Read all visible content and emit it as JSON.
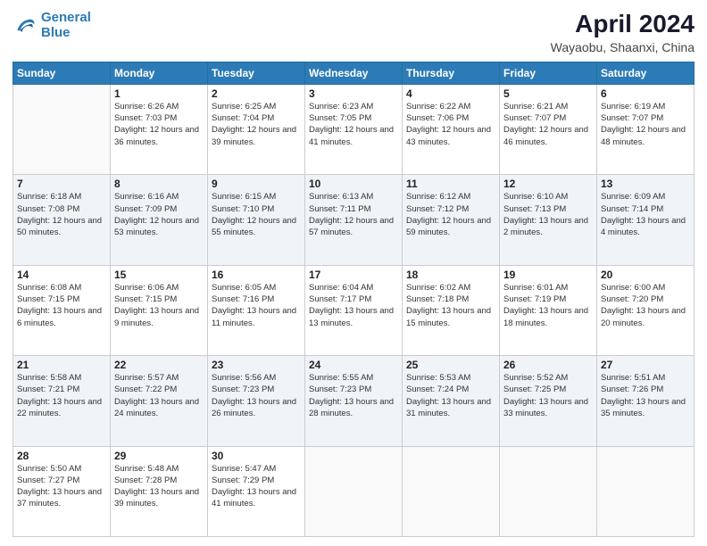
{
  "header": {
    "logo_line1": "General",
    "logo_line2": "Blue",
    "title": "April 2024",
    "subtitle": "Wayaobu, Shaanxi, China"
  },
  "weekdays": [
    "Sunday",
    "Monday",
    "Tuesday",
    "Wednesday",
    "Thursday",
    "Friday",
    "Saturday"
  ],
  "weeks": [
    [
      {
        "day": "",
        "sunrise": "",
        "sunset": "",
        "daylight": ""
      },
      {
        "day": "1",
        "sunrise": "Sunrise: 6:26 AM",
        "sunset": "Sunset: 7:03 PM",
        "daylight": "Daylight: 12 hours and 36 minutes."
      },
      {
        "day": "2",
        "sunrise": "Sunrise: 6:25 AM",
        "sunset": "Sunset: 7:04 PM",
        "daylight": "Daylight: 12 hours and 39 minutes."
      },
      {
        "day": "3",
        "sunrise": "Sunrise: 6:23 AM",
        "sunset": "Sunset: 7:05 PM",
        "daylight": "Daylight: 12 hours and 41 minutes."
      },
      {
        "day": "4",
        "sunrise": "Sunrise: 6:22 AM",
        "sunset": "Sunset: 7:06 PM",
        "daylight": "Daylight: 12 hours and 43 minutes."
      },
      {
        "day": "5",
        "sunrise": "Sunrise: 6:21 AM",
        "sunset": "Sunset: 7:07 PM",
        "daylight": "Daylight: 12 hours and 46 minutes."
      },
      {
        "day": "6",
        "sunrise": "Sunrise: 6:19 AM",
        "sunset": "Sunset: 7:07 PM",
        "daylight": "Daylight: 12 hours and 48 minutes."
      }
    ],
    [
      {
        "day": "7",
        "sunrise": "Sunrise: 6:18 AM",
        "sunset": "Sunset: 7:08 PM",
        "daylight": "Daylight: 12 hours and 50 minutes."
      },
      {
        "day": "8",
        "sunrise": "Sunrise: 6:16 AM",
        "sunset": "Sunset: 7:09 PM",
        "daylight": "Daylight: 12 hours and 53 minutes."
      },
      {
        "day": "9",
        "sunrise": "Sunrise: 6:15 AM",
        "sunset": "Sunset: 7:10 PM",
        "daylight": "Daylight: 12 hours and 55 minutes."
      },
      {
        "day": "10",
        "sunrise": "Sunrise: 6:13 AM",
        "sunset": "Sunset: 7:11 PM",
        "daylight": "Daylight: 12 hours and 57 minutes."
      },
      {
        "day": "11",
        "sunrise": "Sunrise: 6:12 AM",
        "sunset": "Sunset: 7:12 PM",
        "daylight": "Daylight: 12 hours and 59 minutes."
      },
      {
        "day": "12",
        "sunrise": "Sunrise: 6:10 AM",
        "sunset": "Sunset: 7:13 PM",
        "daylight": "Daylight: 13 hours and 2 minutes."
      },
      {
        "day": "13",
        "sunrise": "Sunrise: 6:09 AM",
        "sunset": "Sunset: 7:14 PM",
        "daylight": "Daylight: 13 hours and 4 minutes."
      }
    ],
    [
      {
        "day": "14",
        "sunrise": "Sunrise: 6:08 AM",
        "sunset": "Sunset: 7:15 PM",
        "daylight": "Daylight: 13 hours and 6 minutes."
      },
      {
        "day": "15",
        "sunrise": "Sunrise: 6:06 AM",
        "sunset": "Sunset: 7:15 PM",
        "daylight": "Daylight: 13 hours and 9 minutes."
      },
      {
        "day": "16",
        "sunrise": "Sunrise: 6:05 AM",
        "sunset": "Sunset: 7:16 PM",
        "daylight": "Daylight: 13 hours and 11 minutes."
      },
      {
        "day": "17",
        "sunrise": "Sunrise: 6:04 AM",
        "sunset": "Sunset: 7:17 PM",
        "daylight": "Daylight: 13 hours and 13 minutes."
      },
      {
        "day": "18",
        "sunrise": "Sunrise: 6:02 AM",
        "sunset": "Sunset: 7:18 PM",
        "daylight": "Daylight: 13 hours and 15 minutes."
      },
      {
        "day": "19",
        "sunrise": "Sunrise: 6:01 AM",
        "sunset": "Sunset: 7:19 PM",
        "daylight": "Daylight: 13 hours and 18 minutes."
      },
      {
        "day": "20",
        "sunrise": "Sunrise: 6:00 AM",
        "sunset": "Sunset: 7:20 PM",
        "daylight": "Daylight: 13 hours and 20 minutes."
      }
    ],
    [
      {
        "day": "21",
        "sunrise": "Sunrise: 5:58 AM",
        "sunset": "Sunset: 7:21 PM",
        "daylight": "Daylight: 13 hours and 22 minutes."
      },
      {
        "day": "22",
        "sunrise": "Sunrise: 5:57 AM",
        "sunset": "Sunset: 7:22 PM",
        "daylight": "Daylight: 13 hours and 24 minutes."
      },
      {
        "day": "23",
        "sunrise": "Sunrise: 5:56 AM",
        "sunset": "Sunset: 7:23 PM",
        "daylight": "Daylight: 13 hours and 26 minutes."
      },
      {
        "day": "24",
        "sunrise": "Sunrise: 5:55 AM",
        "sunset": "Sunset: 7:23 PM",
        "daylight": "Daylight: 13 hours and 28 minutes."
      },
      {
        "day": "25",
        "sunrise": "Sunrise: 5:53 AM",
        "sunset": "Sunset: 7:24 PM",
        "daylight": "Daylight: 13 hours and 31 minutes."
      },
      {
        "day": "26",
        "sunrise": "Sunrise: 5:52 AM",
        "sunset": "Sunset: 7:25 PM",
        "daylight": "Daylight: 13 hours and 33 minutes."
      },
      {
        "day": "27",
        "sunrise": "Sunrise: 5:51 AM",
        "sunset": "Sunset: 7:26 PM",
        "daylight": "Daylight: 13 hours and 35 minutes."
      }
    ],
    [
      {
        "day": "28",
        "sunrise": "Sunrise: 5:50 AM",
        "sunset": "Sunset: 7:27 PM",
        "daylight": "Daylight: 13 hours and 37 minutes."
      },
      {
        "day": "29",
        "sunrise": "Sunrise: 5:48 AM",
        "sunset": "Sunset: 7:28 PM",
        "daylight": "Daylight: 13 hours and 39 minutes."
      },
      {
        "day": "30",
        "sunrise": "Sunrise: 5:47 AM",
        "sunset": "Sunset: 7:29 PM",
        "daylight": "Daylight: 13 hours and 41 minutes."
      },
      {
        "day": "",
        "sunrise": "",
        "sunset": "",
        "daylight": ""
      },
      {
        "day": "",
        "sunrise": "",
        "sunset": "",
        "daylight": ""
      },
      {
        "day": "",
        "sunrise": "",
        "sunset": "",
        "daylight": ""
      },
      {
        "day": "",
        "sunrise": "",
        "sunset": "",
        "daylight": ""
      }
    ]
  ]
}
